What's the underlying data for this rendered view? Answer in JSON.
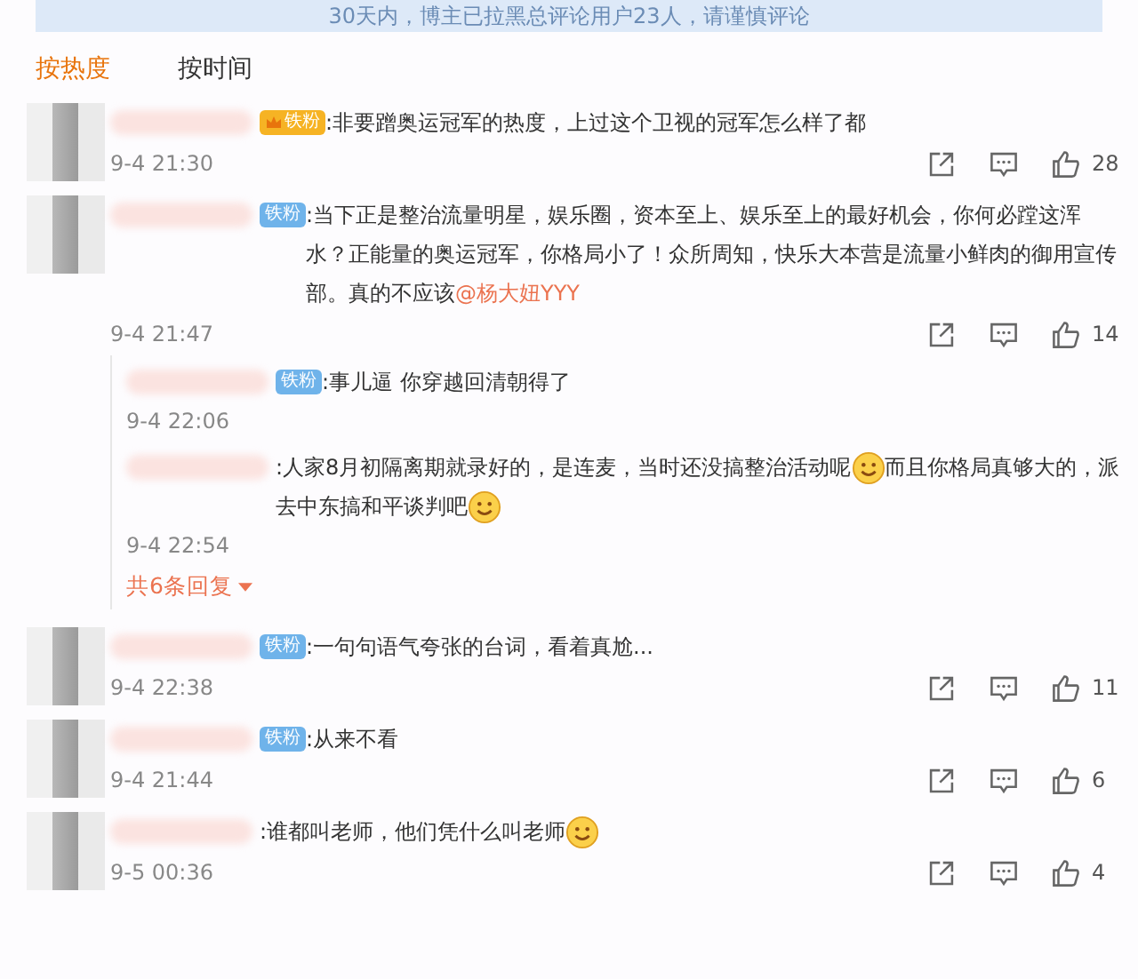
{
  "banner": {
    "text": "30天内，博主已拉黑总评论用户23人，请谨慎评论"
  },
  "tabs": [
    {
      "label": "按热度",
      "selected": true
    },
    {
      "label": "按时间",
      "selected": false
    }
  ],
  "comments": [
    {
      "badge": {
        "label": "铁粉",
        "kind": "gold"
      },
      "parts": [
        {
          "kind": "text",
          "text": ":非要蹭奥运冠军的热度，上过这个卫视的冠军怎么样了都"
        }
      ],
      "time": "9-4 21:30",
      "likes": "28"
    },
    {
      "badge": {
        "label": "铁粉",
        "kind": "blue"
      },
      "parts": [
        {
          "kind": "text",
          "text": ":当下正是整治流量明星，娱乐圈，资本至上、娱乐至上的最好机会，你何必蹚这浑水？正能量的奥运冠军，你格局小了！众所周知，快乐大本营是流量小鲜肉的御用宣传部。真的不应该"
        },
        {
          "kind": "mention",
          "text": "@杨大妞YYY"
        }
      ],
      "time": "9-4 21:47",
      "likes": "14",
      "replies": [
        {
          "badge": {
            "label": "铁粉",
            "kind": "blue"
          },
          "parts": [
            {
              "kind": "text",
              "text": ":事儿逼 你穿越回清朝得了"
            }
          ],
          "time": "9-4 22:06"
        },
        {
          "parts": [
            {
              "kind": "text",
              "text": ":人家8月初隔离期就录好的，是连麦，当时还没搞整治活动呢"
            },
            {
              "kind": "emoji"
            },
            {
              "kind": "text",
              "text": "而且你格局真够大的，派去中东搞和平谈判吧"
            },
            {
              "kind": "emoji"
            }
          ],
          "time": "9-4 22:54"
        }
      ],
      "more_replies": "共6条回复"
    },
    {
      "badge": {
        "label": "铁粉",
        "kind": "blue"
      },
      "parts": [
        {
          "kind": "text",
          "text": ":一句句语气夸张的台词，看着真尬..."
        }
      ],
      "time": "9-4 22:38",
      "likes": "11"
    },
    {
      "badge": {
        "label": "铁粉",
        "kind": "blue"
      },
      "parts": [
        {
          "kind": "text",
          "text": ":从来不看"
        }
      ],
      "time": "9-4 21:44",
      "likes": "6"
    },
    {
      "parts": [
        {
          "kind": "text",
          "text": ":谁都叫老师，他们凭什么叫老师"
        },
        {
          "kind": "emoji"
        }
      ],
      "time": "9-5 00:36",
      "likes": "4"
    }
  ]
}
